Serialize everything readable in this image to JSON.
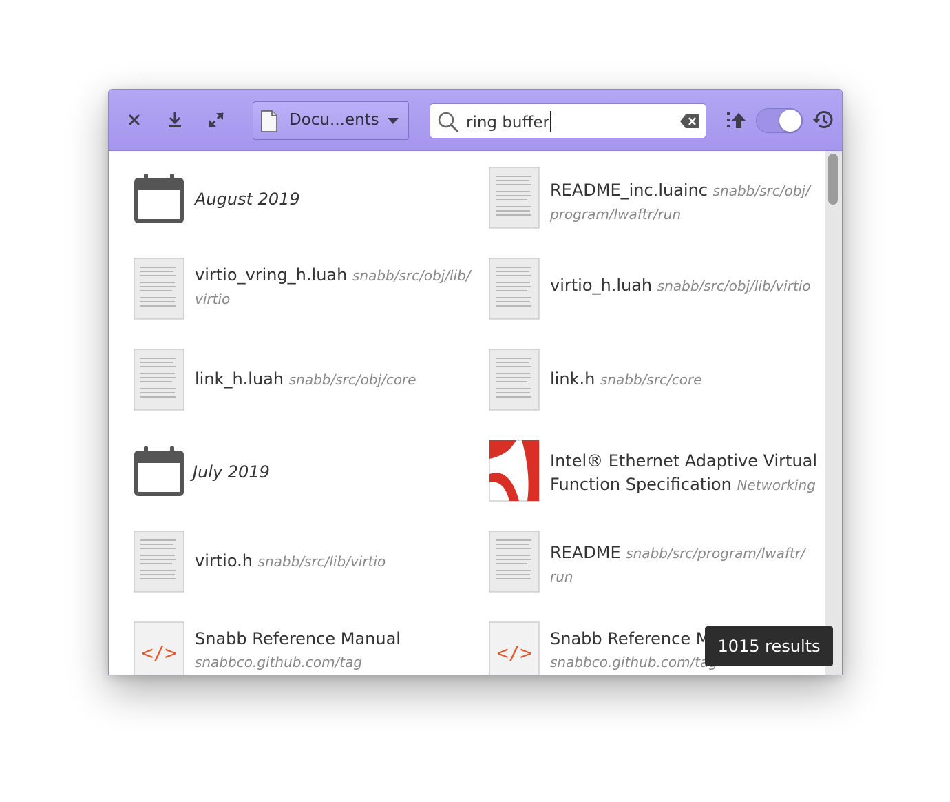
{
  "toolbar": {
    "location_label": "Docu...ents",
    "search_value": "ring buffer"
  },
  "results": {
    "left": [
      {
        "type": "date",
        "title": "August 2019"
      },
      {
        "type": "text",
        "title": "virtio_vring_h.luah",
        "path": "snabb/src/obj/lib/",
        "path2": "virtio"
      },
      {
        "type": "text",
        "title": "link_h.luah",
        "path": "snabb/src/obj/core"
      },
      {
        "type": "date",
        "title": "July 2019"
      },
      {
        "type": "text",
        "title": "virtio.h",
        "path": "snabb/src/lib/virtio"
      },
      {
        "type": "html",
        "title": "Snabb Reference Manual",
        "path2": "snabbco.github.com/tag"
      }
    ],
    "right": [
      {
        "type": "text",
        "title": "README_inc.luainc",
        "path": "snabb/src/obj/",
        "path2": "program/lwaftr/run"
      },
      {
        "type": "text",
        "title": "virtio_h.luah",
        "path": "snabb/src/obj/lib/virtio"
      },
      {
        "type": "text",
        "title": "link.h",
        "path": "snabb/src/core"
      },
      {
        "type": "pdf",
        "title": "Intel® Ethernet Adaptive Virtual",
        "title2": "Function Specification",
        "path": "Networking"
      },
      {
        "type": "text",
        "title": "README",
        "path": "snabb/src/program/lwaftr/",
        "path2": "run"
      },
      {
        "type": "html",
        "title": "Snabb Reference Manual",
        "path2": "snabbco.github.com/tag"
      }
    ]
  },
  "status": {
    "results_count": "1015 results"
  }
}
